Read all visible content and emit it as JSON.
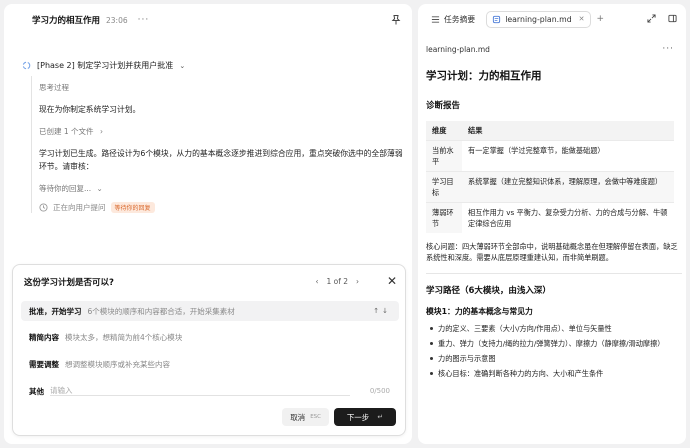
{
  "left_header": {
    "title": "学习力的相互作用",
    "time": "23:06"
  },
  "phase": {
    "label": "[Phase 2] 制定学习计划并获用户批准"
  },
  "thread": {
    "thinking": "思考过程",
    "message1": "现在为你制定系统学习计划。",
    "created_files": "已创建 1 个文件",
    "message2": "学习计划已生成。路径设计为6个模块，从力的基本概念逐步推进到综合应用，重点突破你选中的全部薄弱环节。请审核：",
    "waiting": "等待你的回复...",
    "asking": "正在向用户提问",
    "asking_badge": "等待你的回复"
  },
  "question_card": {
    "question": "这份学习计划是否可以?",
    "pager": "1 of 2",
    "options": [
      {
        "key": "批准，开始学习",
        "desc": "6个模块的顺序和内容都合适，开始采集素材"
      },
      {
        "key": "精简内容",
        "desc": "模块太多，想精简为前4个核心模块"
      },
      {
        "key": "需要调整",
        "desc": "想调整模块顺序或补充某些内容"
      }
    ],
    "other_label": "其他",
    "other_placeholder": "请输入",
    "counter": "0/500",
    "cancel_label": "取消",
    "cancel_kbd": "ESC",
    "next_label": "下一步",
    "next_kbd": "↵"
  },
  "right_tabs": {
    "summary": "任务摘要",
    "file": "learning-plan.md"
  },
  "file_name": "learning-plan.md",
  "doc": {
    "h1": "学习计划：力的相互作用",
    "diag_title": "诊断报告",
    "table": {
      "headers": [
        "维度",
        "结果"
      ],
      "rows": [
        [
          "当前水平",
          "有一定掌握（学过完整章节，能做基础题）"
        ],
        [
          "学习目标",
          "系统掌握（建立完整知识体系，理解原理，会做中等难度题）"
        ],
        [
          "薄弱环节",
          "相互作用力 vs 平衡力、复杂受力分析、力的合成与分解、牛顿定律综合应用"
        ]
      ]
    },
    "core_issue": "核心问题：四大薄弱环节全部命中，说明基础概念虽在但理解停留在表面，缺乏系统性和深度。需要从底层原理重建认知，而非简单刷题。",
    "path_title": "学习路径（6大模块，由浅入深）",
    "module1_title": "模块1：力的基本概念与常见力",
    "module1_items": [
      "力的定义、三要素（大小/方向/作用点）、单位与矢量性",
      "重力、弹力（支持力/绳的拉力/弹簧弹力）、摩擦力（静摩擦/滑动摩擦）",
      "力的图示与示意图",
      "核心目标：准确判断各种力的方向、大小和产生条件"
    ]
  }
}
